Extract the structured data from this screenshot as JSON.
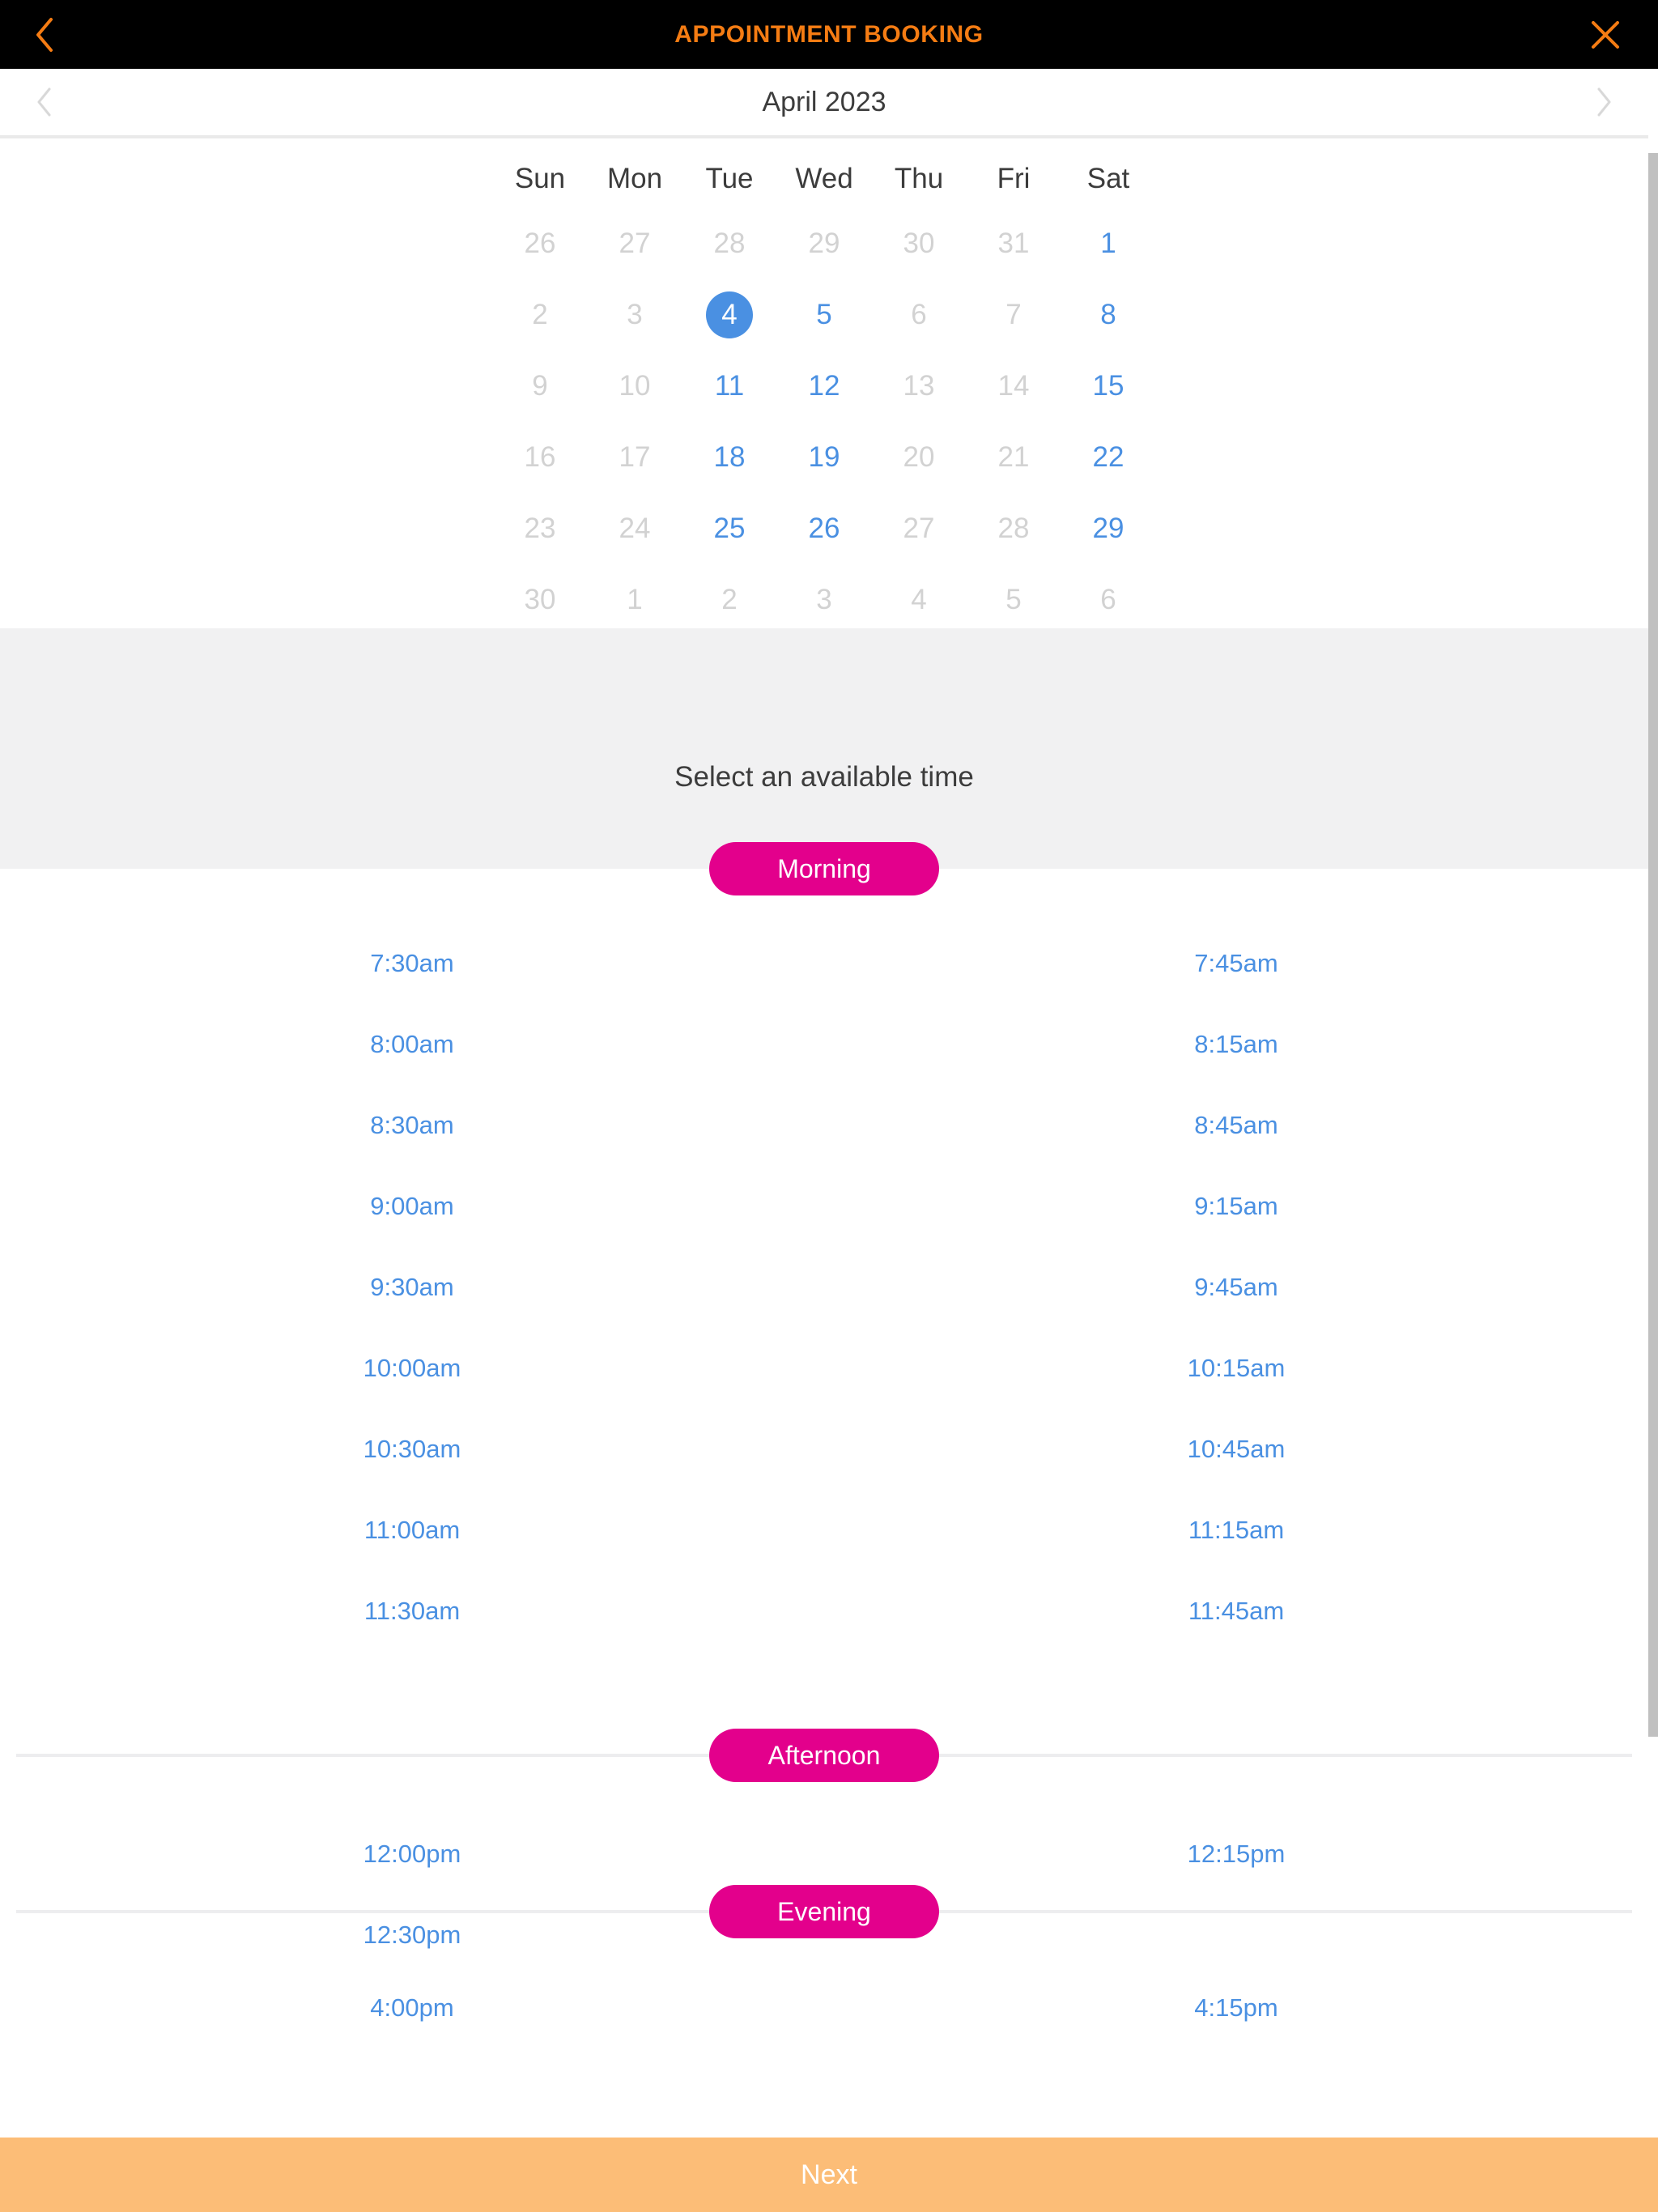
{
  "topbar": {
    "title": "APPOINTMENT BOOKING",
    "back_icon": "chevron-left-icon",
    "close_icon": "close-icon",
    "title_color": "#f57c13",
    "bg_color": "#000000"
  },
  "month_header": {
    "label": "April 2023",
    "prev_icon": "chevron-left-icon",
    "next_icon": "chevron-right-icon"
  },
  "calendar": {
    "day_names": [
      "Sun",
      "Mon",
      "Tue",
      "Wed",
      "Thu",
      "Fri",
      "Sat"
    ],
    "selected_day": "4",
    "selected_color": "#4a90e2",
    "available_color": "#4a90e2",
    "muted_color": "#d2d2d2",
    "weeks": [
      [
        {
          "label": "26",
          "state": "muted"
        },
        {
          "label": "27",
          "state": "muted"
        },
        {
          "label": "28",
          "state": "muted"
        },
        {
          "label": "29",
          "state": "muted"
        },
        {
          "label": "30",
          "state": "muted"
        },
        {
          "label": "31",
          "state": "muted"
        },
        {
          "label": "1",
          "state": "available"
        }
      ],
      [
        {
          "label": "2",
          "state": "muted"
        },
        {
          "label": "3",
          "state": "muted"
        },
        {
          "label": "4",
          "state": "selected"
        },
        {
          "label": "5",
          "state": "available"
        },
        {
          "label": "6",
          "state": "muted"
        },
        {
          "label": "7",
          "state": "muted"
        },
        {
          "label": "8",
          "state": "available"
        }
      ],
      [
        {
          "label": "9",
          "state": "muted"
        },
        {
          "label": "10",
          "state": "muted"
        },
        {
          "label": "11",
          "state": "available"
        },
        {
          "label": "12",
          "state": "available"
        },
        {
          "label": "13",
          "state": "muted"
        },
        {
          "label": "14",
          "state": "muted"
        },
        {
          "label": "15",
          "state": "available"
        }
      ],
      [
        {
          "label": "16",
          "state": "muted"
        },
        {
          "label": "17",
          "state": "muted"
        },
        {
          "label": "18",
          "state": "available"
        },
        {
          "label": "19",
          "state": "available"
        },
        {
          "label": "20",
          "state": "muted"
        },
        {
          "label": "21",
          "state": "muted"
        },
        {
          "label": "22",
          "state": "available"
        }
      ],
      [
        {
          "label": "23",
          "state": "muted"
        },
        {
          "label": "24",
          "state": "muted"
        },
        {
          "label": "25",
          "state": "available"
        },
        {
          "label": "26",
          "state": "available"
        },
        {
          "label": "27",
          "state": "muted"
        },
        {
          "label": "28",
          "state": "muted"
        },
        {
          "label": "29",
          "state": "available"
        }
      ],
      [
        {
          "label": "30",
          "state": "muted"
        },
        {
          "label": "1",
          "state": "muted"
        },
        {
          "label": "2",
          "state": "muted"
        },
        {
          "label": "3",
          "state": "muted"
        },
        {
          "label": "4",
          "state": "muted"
        },
        {
          "label": "5",
          "state": "muted"
        },
        {
          "label": "6",
          "state": "muted"
        }
      ]
    ]
  },
  "time_picker": {
    "heading": "Select an available time",
    "pill_color": "#e3008c",
    "slot_color": "#4a90e2",
    "sections": [
      {
        "label": "Morning",
        "rows": [
          [
            "7:30am",
            "7:45am"
          ],
          [
            "8:00am",
            "8:15am"
          ],
          [
            "8:30am",
            "8:45am"
          ],
          [
            "9:00am",
            "9:15am"
          ],
          [
            "9:30am",
            "9:45am"
          ],
          [
            "10:00am",
            "10:15am"
          ],
          [
            "10:30am",
            "10:45am"
          ],
          [
            "11:00am",
            "11:15am"
          ],
          [
            "11:30am",
            "11:45am"
          ]
        ]
      },
      {
        "label": "Afternoon",
        "rows": [
          [
            "12:00pm",
            "12:15pm"
          ],
          [
            "12:30pm",
            ""
          ]
        ]
      },
      {
        "label": "Evening",
        "rows": [
          [
            "4:00pm",
            "4:15pm"
          ]
        ]
      }
    ]
  },
  "footer": {
    "next_label": "Next",
    "next_bg": "#fcbd77"
  }
}
